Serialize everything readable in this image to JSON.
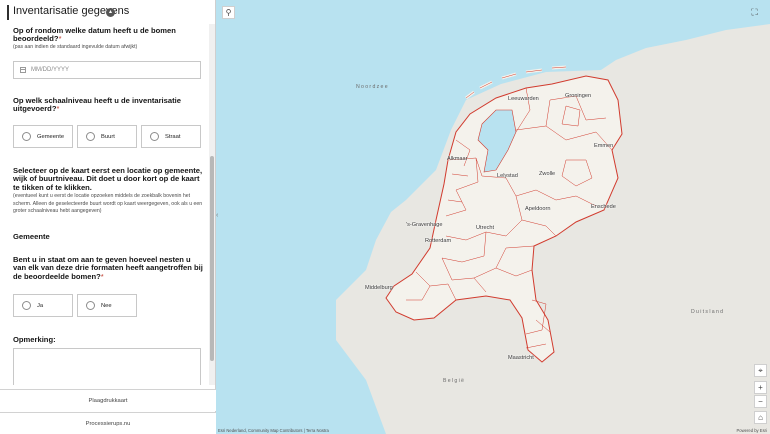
{
  "panel": {
    "title": "Inventarisatie gegevens",
    "collapse_icon": "chevron-up-icon"
  },
  "form": {
    "q_date": {
      "label": "Op of rondom welke datum heeft u de bomen beoordeeld?",
      "required_mark": "*",
      "hint": "(pas aan indien de standaard ingevulde datum afwijkt)",
      "placeholder": "MM/DD/YYYY"
    },
    "q_level": {
      "label": "Op welk schaalniveau heeft u de inventarisatie uitgevoerd?",
      "required_mark": "*",
      "options": [
        "Gemeente",
        "Buurt",
        "Straat"
      ]
    },
    "q_location": {
      "label": "Selecteer op de kaart eerst een locatie op gemeente, wijk of buurtniveau. Dit doet u door kort op de kaart te tikken of te klikken.",
      "hint": "(eventueel kunt u eerst de locatie opzoeken middels de zoekbalk bovenin het scherm. Alleen de geselecteerde buurt wordt op kaart weergegeven, ook als u een groter schaalniveau hebt aangegeven)"
    },
    "selected_level_label": "Gemeente",
    "q_nests": {
      "label": "Bent u in staat om aan te geven hoeveel nesten u van elk van deze drie formaten heeft aangetroffen bij de beoordeelde bomen?",
      "required_mark": "*",
      "options": [
        "Ja",
        "Nee"
      ]
    },
    "remark_label": "Opmerking:"
  },
  "footer": {
    "button1": "Plaagdrukkaart",
    "button2": "Processierups.nu"
  },
  "map": {
    "sea_label": "Noordzee",
    "germany_label": "Duitsland",
    "belgium_label": "België",
    "cities": [
      "Leeuwarden",
      "Groningen",
      "Emmen",
      "Alkmaar",
      "Lelystad",
      "Zwolle",
      "Apeldoorn",
      "Enschede",
      "'s-Gravenhage",
      "Rotterdam",
      "Utrecht",
      "Middelburg",
      "Maastricht"
    ],
    "attribution": "Esri Nederland, Community Map Contributors | Terra Nostra",
    "powered_by": "Powered by Esri",
    "colors": {
      "water": "#b8e2f0",
      "land": "#e8e7e2",
      "netherlands": "#f4f2ec",
      "boundary": "#d13b2e"
    }
  }
}
